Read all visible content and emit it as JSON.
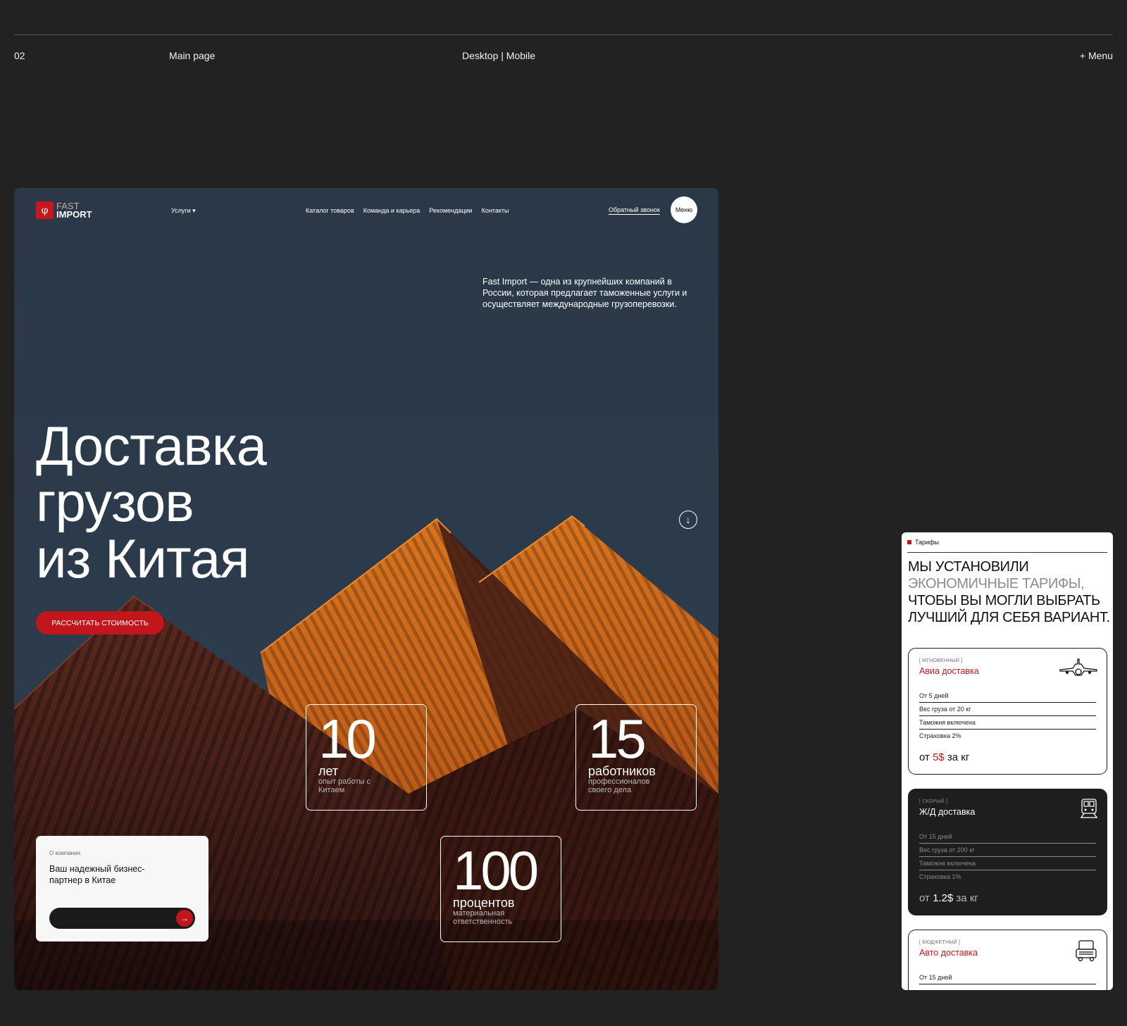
{
  "presentation": {
    "number": "02",
    "page": "Main page",
    "mode": "Desktop | Mobile",
    "menu": "+ Menu"
  },
  "site": {
    "logo": {
      "line1": "FAST",
      "line2": "IMPORT",
      "mark": "φ"
    },
    "nav": {
      "services": "Услуги ▾",
      "links": [
        "Каталог товаров",
        "Команда и карьера",
        "Рекомендации",
        "Контакты"
      ],
      "callback": "Обратный звонок",
      "menu": "Меню"
    },
    "hero": {
      "intro": "Fast Import — одна из крупнейших компаний в России, которая предлагает таможенные услуги и осуществляет международные грузоперевозки.",
      "title_lines": [
        "Доставка",
        "грузов",
        "из Китая"
      ],
      "cta": "РАССЧИТАТЬ СТОИМОСТЬ",
      "scroll_icon": "arrow-down-icon"
    },
    "stats": [
      {
        "num": "10",
        "unit": "лет",
        "desc": "опыт работы с Китаем"
      },
      {
        "num": "15",
        "unit": "работников",
        "desc": "профессионалов своего дела"
      },
      {
        "num": "100",
        "unit": "процентов",
        "desc": "материальная ответственность"
      }
    ],
    "about": {
      "label": "О компании",
      "text": "Ваш надежный бизнес-партнер в Китае"
    }
  },
  "mobile": {
    "tag": "Тарифы",
    "heading": {
      "part1": "МЫ УСТАНОВИЛИ ",
      "part2": "ЭКОНОМИЧНЫЕ ТАРИФЫ,",
      "part3": " ЧТОБЫ ВЫ МОГЛИ ВЫБРАТЬ ЛУЧШИЙ ДЛЯ СЕБЯ ВАРИАНТ."
    },
    "tariffs": [
      {
        "kind": "[ МГНОВЕННЫЙ ]",
        "name": "Авиа доставка",
        "icon": "airplane-icon",
        "rows": [
          "От 5 дней",
          "Вес груза от 20 кг",
          "Таможня включена",
          "Страховка 2%"
        ],
        "price_prefix": "от ",
        "price_value": "5$",
        "price_suffix": " за кг"
      },
      {
        "kind": "[ СКОРЫЙ ]",
        "name": "Ж/Д доставка",
        "icon": "train-icon",
        "rows": [
          "От 15 дней",
          "Вес груза от 200 кг",
          "Таможня включена",
          "Страховка 1%"
        ],
        "price_prefix": "от ",
        "price_value": "1.2$",
        "price_suffix": " за кг"
      },
      {
        "kind": "[ БЮДЖЕТНЫЙ ]",
        "name": "Авто доставка",
        "icon": "truck-icon",
        "rows": [
          "От 15 дней"
        ]
      }
    ]
  },
  "colors": {
    "accent": "#c1161c",
    "background": "#222222",
    "sky": "#2c3b4b",
    "container_orange": "#c2621a",
    "container_rust": "#4a1f18"
  }
}
